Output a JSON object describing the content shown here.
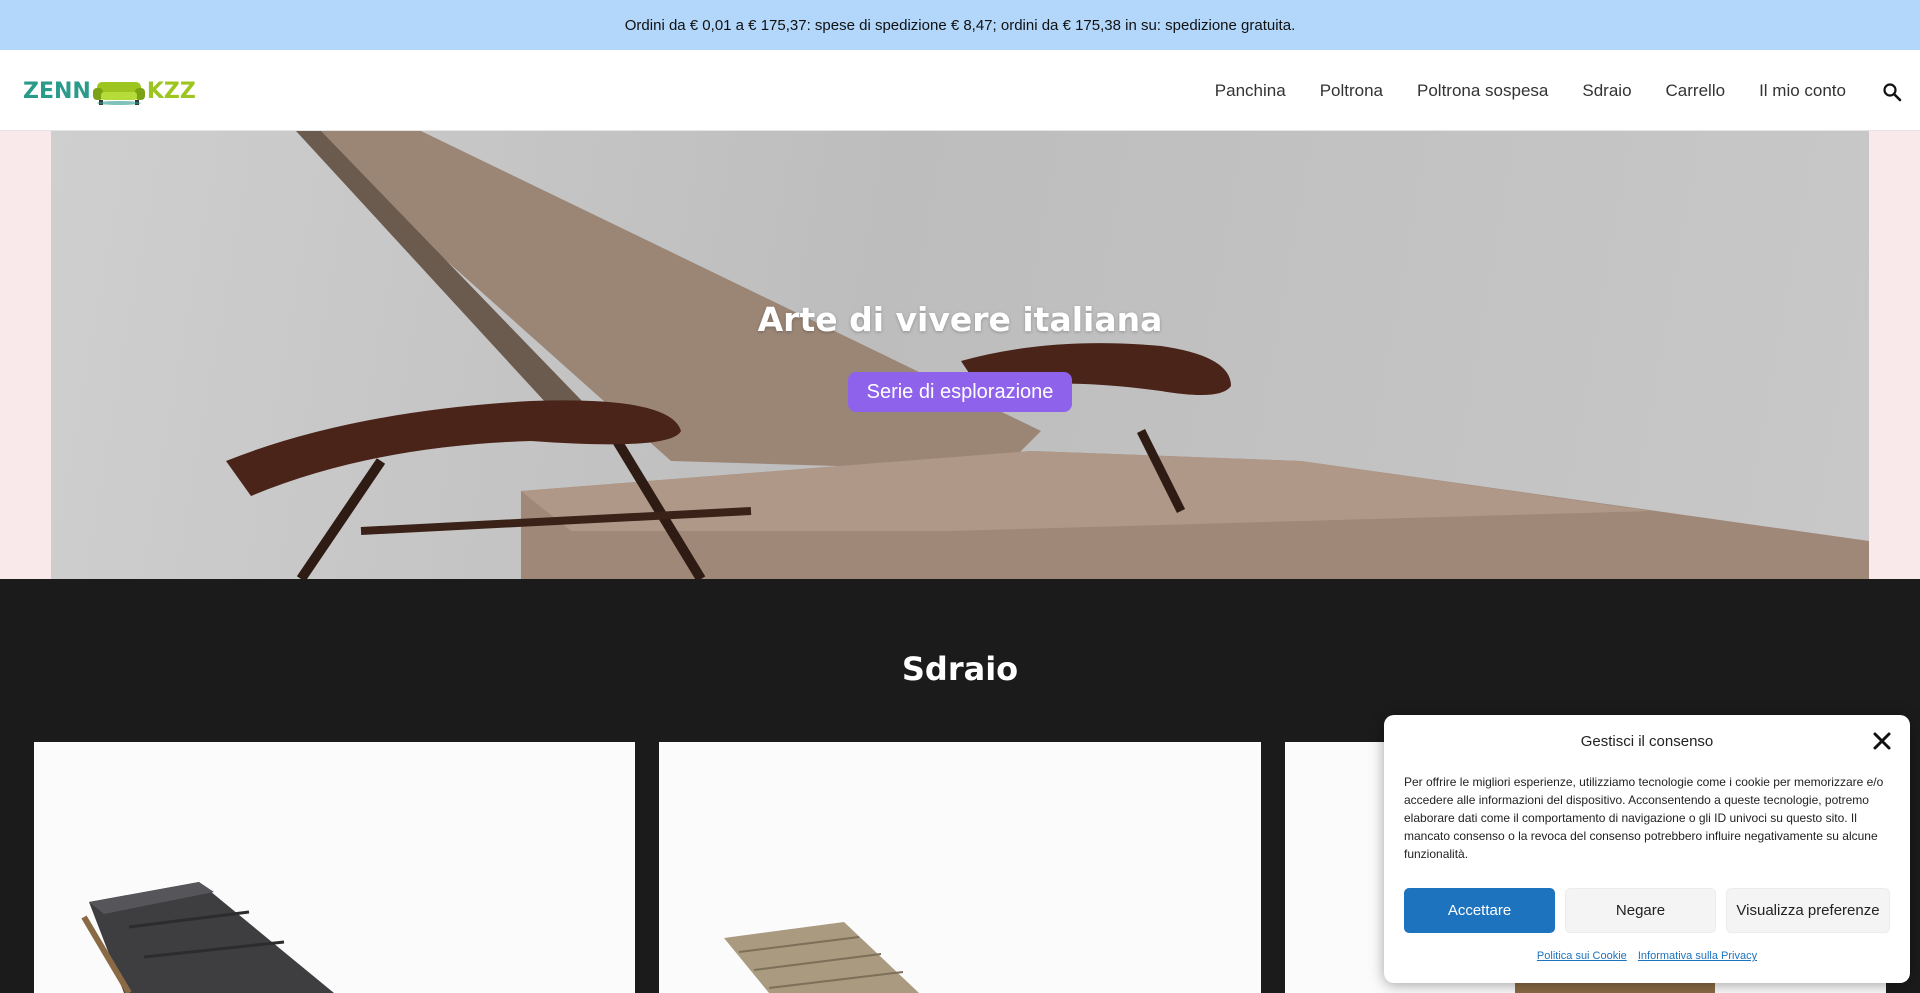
{
  "announcement": "Ordini da € 0,01 a € 175,37: spese di spedizione € 8,47; ordini da € 175,38 in su: spedizione gratuita.",
  "logo": {
    "left": "ZENN",
    "right": "KZZ"
  },
  "nav": {
    "items": [
      "Panchina",
      "Poltrona",
      "Poltrona sospesa",
      "Sdraio",
      "Carrello",
      "Il mio conto"
    ],
    "search_icon": "search-icon"
  },
  "hero": {
    "title": "Arte di vivere italiana",
    "button": "Serie di esplorazione"
  },
  "section": {
    "title": "Sdraio"
  },
  "consent": {
    "title": "Gestisci il consenso",
    "body": "Per offrire le migliori esperienze, utilizziamo tecnologie come i cookie per memorizzare e/o accedere alle informazioni del dispositivo. Acconsentendo a queste tecnologie, potremo elaborare dati come il comportamento di navigazione o gli ID univoci su questo sito. Il mancato consenso o la revoca del consenso potrebbero influire negativamente su alcune funzionalità.",
    "accept": "Accettare",
    "deny": "Negare",
    "preferences": "Visualizza preferenze",
    "cookie_policy": "Politica sui Cookie",
    "privacy": "Informativa sulla Privacy"
  },
  "colors": {
    "topbar": "#b2d7fb",
    "accent_button": "#8f62ec",
    "consent_accept": "#1e73be",
    "section_bg": "#1b1b1b"
  }
}
